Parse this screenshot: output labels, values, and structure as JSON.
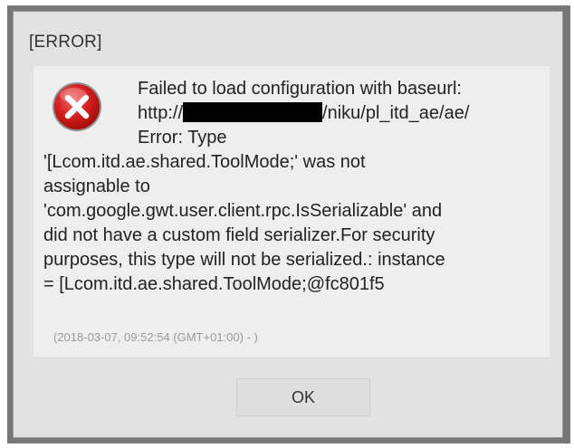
{
  "dialog": {
    "title": "[ERROR]",
    "icon": "error-icon",
    "message_lines": {
      "line1": "Failed to load configuration with baseurl:",
      "line2_prefix": "http://",
      "line2_suffix": "/niku/pl_itd_ae/ae/",
      "line3": "Error: Type",
      "line4": "'[Lcom.itd.ae.shared.ToolMode;' was not",
      "line5": "assignable to",
      "line6": "'com.google.gwt.user.client.rpc.IsSerializable' and",
      "line7": "did not have a custom field serializer.For security",
      "line8": "purposes, this type will not be serialized.: instance",
      "line9": "= [Lcom.itd.ae.shared.ToolMode;@fc801f5"
    },
    "timestamp": "(2018-03-07, 09:52:54 (GMT+01:00) - )",
    "ok_label": "OK"
  },
  "colors": {
    "icon_red": "#d61f1f",
    "dialog_bg": "#e2e2e2",
    "content_bg": "#eeeeee",
    "frame": "#777777"
  }
}
